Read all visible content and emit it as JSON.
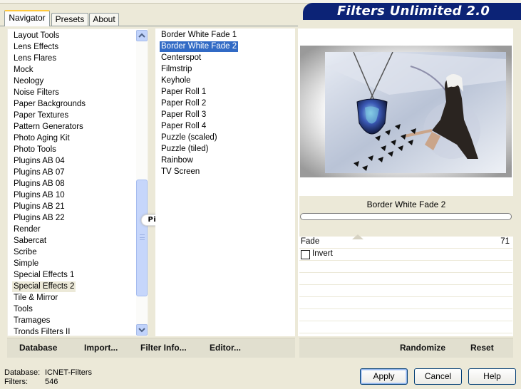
{
  "tabs": [
    "Navigator",
    "Presets",
    "About"
  ],
  "banner_title": "Filters Unlimited 2.0",
  "categories": [
    "Layout Tools",
    "Lens Effects",
    "Lens Flares",
    "Mock",
    "Neology",
    "Noise Filters",
    "Paper Backgrounds",
    "Paper Textures",
    "Pattern Generators",
    "Photo Aging Kit",
    "Photo Tools",
    "Plugins AB 04",
    "Plugins AB 07",
    "Plugins AB 08",
    "Plugins AB 10",
    "Plugins AB 21",
    "Plugins AB 22",
    "Render",
    "Sabercat",
    "Scribe",
    "Simple",
    "Special Effects 1",
    "Special Effects 2",
    "Tile & Mirror",
    "Tools",
    "Tramages",
    "Tronds Filters II"
  ],
  "selected_category": "Special Effects 2",
  "filters": [
    "Border White Fade 1",
    "Border White Fade 2",
    "Centerspot",
    "Filmstrip",
    "Keyhole",
    "Paper Roll 1",
    "Paper Roll 2",
    "Paper Roll 3",
    "Paper Roll 4",
    "Puzzle (scaled)",
    "Puzzle (tiled)",
    "Rainbow",
    "TV Screen"
  ],
  "selected_filter": "Border White Fade 2",
  "watermark": "Pinuccia",
  "toolbar": {
    "database": "Database",
    "import": "Import...",
    "filter_info": "Filter Info...",
    "editor": "Editor..."
  },
  "preview_filter_name": "Border White Fade 2",
  "params": {
    "fade_label": "Fade",
    "fade_value": "71",
    "invert_label": "Invert",
    "invert_checked": false
  },
  "right_toolbar": {
    "randomize": "Randomize",
    "reset": "Reset"
  },
  "status": {
    "database_label": "Database:",
    "database_value": "ICNET-Filters",
    "filters_label": "Filters:",
    "filters_value": "546"
  },
  "buttons": {
    "apply": "Apply",
    "cancel": "Cancel",
    "help": "Help"
  },
  "colors": {
    "banner": "#0c2376",
    "selection_blue": "#316ac5",
    "selection_gray": "#ece9d8",
    "background": "#ece9d8"
  },
  "icons": {
    "scroll_up": "chevron-up-icon",
    "scroll_down": "chevron-down-icon"
  }
}
